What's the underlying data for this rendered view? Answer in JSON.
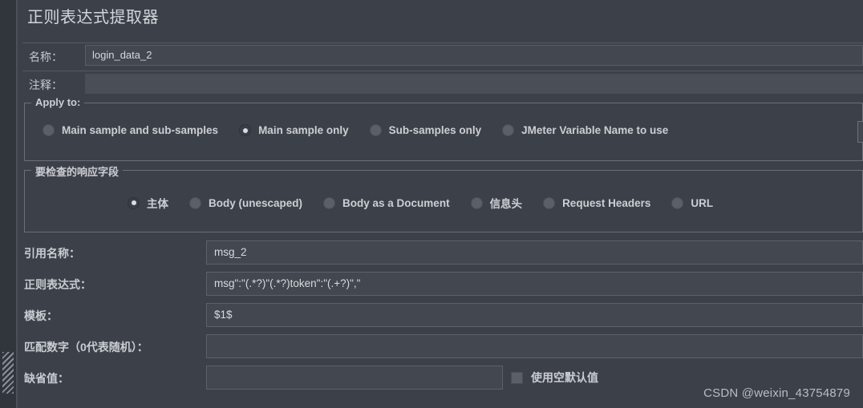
{
  "panel": {
    "title": "正则表达式提取器"
  },
  "header": {
    "name_label": "名称：",
    "name_value": "login_data_2",
    "comment_label": "注释：",
    "comment_value": ""
  },
  "apply_to": {
    "legend": "Apply to:",
    "options": [
      {
        "label": "Main sample and sub-samples",
        "selected": false
      },
      {
        "label": "Main sample only",
        "selected": true
      },
      {
        "label": "Sub-samples only",
        "selected": false
      },
      {
        "label": "JMeter Variable Name to use",
        "selected": false
      }
    ],
    "variable_name_value": ""
  },
  "response_field": {
    "legend": "要检查的响应字段",
    "options": [
      {
        "label": "主体",
        "selected": true
      },
      {
        "label": "Body (unescaped)",
        "selected": false
      },
      {
        "label": "Body as a Document",
        "selected": false
      },
      {
        "label": "信息头",
        "selected": false
      },
      {
        "label": "Request Headers",
        "selected": false
      },
      {
        "label": "URL",
        "selected": false
      }
    ]
  },
  "form": {
    "reference_name_label": "引用名称：",
    "reference_name_value": "msg_2",
    "regex_label": "正则表达式：",
    "regex_value": "msg\":\"(.*?)\"(.*?)token\":\"(.+?)\",\"",
    "template_label": "模板：",
    "template_value": "$1$",
    "match_no_label": "匹配数字（0代表随机）：",
    "match_no_value": "",
    "default_value_label": "缺省值：",
    "default_value_value": "",
    "use_empty_default_label": "使用空默认值",
    "use_empty_default_checked": false
  },
  "watermark": {
    "text": "CSDN @weixin_43754879"
  },
  "colors": {
    "background": "#3c4149",
    "gutter": "#31353c",
    "field_background": "#43474f",
    "field_border": "#5d626a",
    "text": "#c9ccd1"
  }
}
